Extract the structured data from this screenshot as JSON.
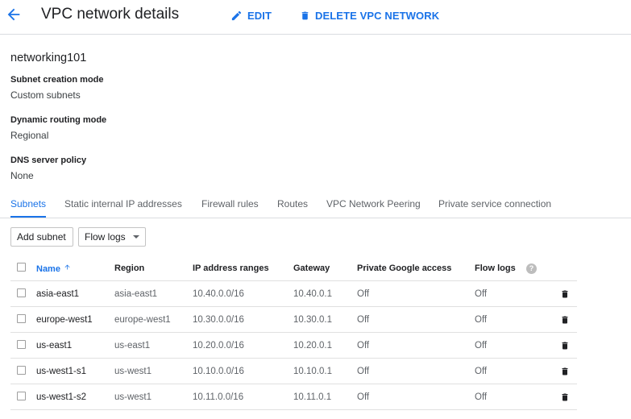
{
  "header": {
    "title": "VPC network details",
    "edit_label": "EDIT",
    "delete_label": "DELETE VPC NETWORK"
  },
  "network": {
    "name": "networking101",
    "properties": [
      {
        "label": "Subnet creation mode",
        "value": "Custom subnets"
      },
      {
        "label": "Dynamic routing mode",
        "value": "Regional"
      },
      {
        "label": "DNS server policy",
        "value": "None"
      }
    ]
  },
  "tabs": [
    {
      "label": "Subnets",
      "active": true
    },
    {
      "label": "Static internal IP addresses",
      "active": false
    },
    {
      "label": "Firewall rules",
      "active": false
    },
    {
      "label": "Routes",
      "active": false
    },
    {
      "label": "VPC Network Peering",
      "active": false
    },
    {
      "label": "Private service connection",
      "active": false
    }
  ],
  "toolbar": {
    "add_subnet_label": "Add subnet",
    "flow_logs_label": "Flow logs"
  },
  "table": {
    "columns": [
      "Name",
      "Region",
      "IP address ranges",
      "Gateway",
      "Private Google access",
      "Flow logs"
    ],
    "sort_column": "Name",
    "sort_direction": "ascending",
    "rows": [
      {
        "name": "asia-east1",
        "region": "asia-east1",
        "ip_range": "10.40.0.0/16",
        "gateway": "10.40.0.1",
        "private_access": "Off",
        "flow_logs": "Off"
      },
      {
        "name": "europe-west1",
        "region": "europe-west1",
        "ip_range": "10.30.0.0/16",
        "gateway": "10.30.0.1",
        "private_access": "Off",
        "flow_logs": "Off"
      },
      {
        "name": "us-east1",
        "region": "us-east1",
        "ip_range": "10.20.0.0/16",
        "gateway": "10.20.0.1",
        "private_access": "Off",
        "flow_logs": "Off"
      },
      {
        "name": "us-west1-s1",
        "region": "us-west1",
        "ip_range": "10.10.0.0/16",
        "gateway": "10.10.0.1",
        "private_access": "Off",
        "flow_logs": "Off"
      },
      {
        "name": "us-west1-s2",
        "region": "us-west1",
        "ip_range": "10.11.0.0/16",
        "gateway": "10.11.0.1",
        "private_access": "Off",
        "flow_logs": "Off"
      }
    ]
  },
  "icons": {
    "back": "arrow-back-icon",
    "edit": "pencil-icon",
    "delete": "trash-icon",
    "help": "help-icon",
    "sort": "sort-ascending-icon"
  },
  "colors": {
    "accent": "#1a73e8",
    "text": "#202124",
    "muted": "#5f6368",
    "divider": "#dadce0"
  }
}
